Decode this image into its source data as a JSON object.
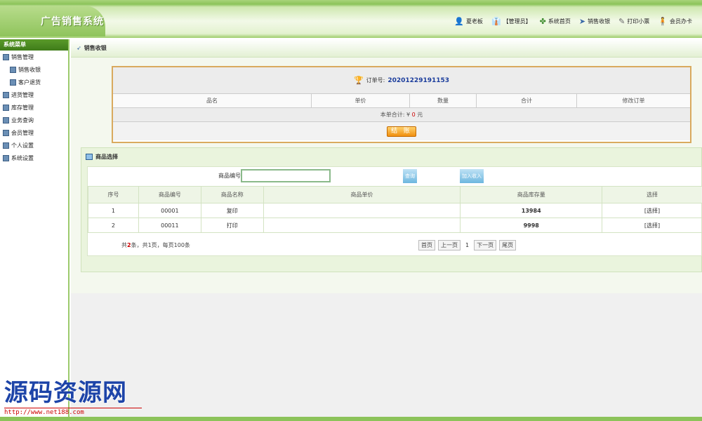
{
  "header": {
    "title": "广告销售系统",
    "nav": [
      {
        "icon": "user-icon",
        "glyph": "👤",
        "label": "夏老板"
      },
      {
        "icon": "admin-icon",
        "glyph": "👔",
        "label": "【管理员】"
      },
      {
        "icon": "home-icon",
        "glyph": "✤",
        "label": "系统首页"
      },
      {
        "icon": "cart-icon",
        "glyph": "➤",
        "label": "销售收银"
      },
      {
        "icon": "print-icon",
        "glyph": "✎",
        "label": "打印小票"
      },
      {
        "icon": "member-icon",
        "glyph": "🧍",
        "label": "会员办卡"
      }
    ]
  },
  "sidebar": {
    "header": "系统菜单",
    "items": [
      {
        "label": "销售管理",
        "sub": false
      },
      {
        "label": "销售收银",
        "sub": true
      },
      {
        "label": "客户退货",
        "sub": true
      },
      {
        "label": "进货管理",
        "sub": false
      },
      {
        "label": "库存管理",
        "sub": false
      },
      {
        "label": "业务查询",
        "sub": false
      },
      {
        "label": "会员管理",
        "sub": false
      },
      {
        "label": "个人设置",
        "sub": false
      },
      {
        "label": "系统设置",
        "sub": false
      }
    ]
  },
  "main": {
    "title": "销售收银",
    "order": {
      "no_label": "订单号:",
      "no_value": "20201229191153",
      "columns": [
        "品名",
        "单价",
        "数量",
        "合计",
        "修改订单"
      ],
      "total_label": "本单合计:",
      "total_currency": "¥",
      "total_value": "0",
      "total_unit": "元",
      "pay_button": "结 账"
    },
    "product": {
      "title": "商品选择",
      "search_label": "商品编号:",
      "search_value": "",
      "query_button": "查询",
      "add_button": "加入收入",
      "columns": [
        "序号",
        "商品编号",
        "商品名称",
        "商品单价",
        "商品库存量",
        "选择"
      ],
      "rows": [
        {
          "no": "1",
          "code": "00001",
          "name": "复印",
          "price": "",
          "stock": "13984",
          "select": "[选择]"
        },
        {
          "no": "2",
          "code": "00011",
          "name": "打印",
          "price": "",
          "stock": "9998",
          "select": "[选择]"
        }
      ],
      "pager": {
        "prefix": "共",
        "count": "2",
        "suffix": "条，共1页，每页100条",
        "first": "首页",
        "prev": "上一页",
        "current": "1",
        "next": "下一页",
        "last": "尾页"
      }
    }
  },
  "watermark": {
    "text": "源码资源网",
    "url": "http://www.net188.com"
  }
}
